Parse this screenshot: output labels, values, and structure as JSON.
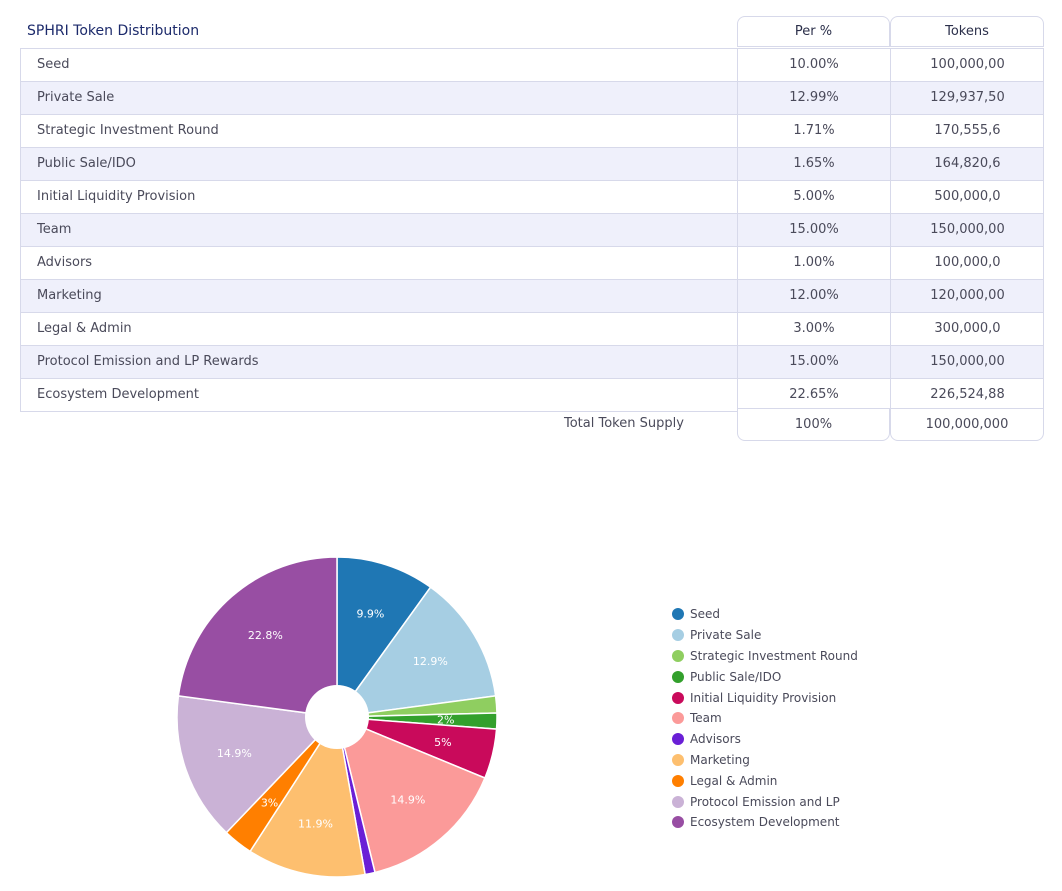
{
  "table": {
    "title": "SPHRI Token Distribution",
    "headers": {
      "per": "Per %",
      "tokens": "Tokens"
    },
    "rows": [
      {
        "name": "Seed",
        "per": "10.00%",
        "tokens": "100,000,00"
      },
      {
        "name": "Private Sale",
        "per": "12.99%",
        "tokens": "129,937,50"
      },
      {
        "name": "Strategic Investment Round",
        "per": "1.71%",
        "tokens": "170,555,6"
      },
      {
        "name": "Public Sale/IDO",
        "per": "1.65%",
        "tokens": "164,820,6"
      },
      {
        "name": "Initial Liquidity Provision",
        "per": "5.00%",
        "tokens": "500,000,0"
      },
      {
        "name": "Team",
        "per": "15.00%",
        "tokens": "150,000,00"
      },
      {
        "name": "Advisors",
        "per": "1.00%",
        "tokens": "100,000,0"
      },
      {
        "name": "Marketing",
        "per": "12.00%",
        "tokens": "120,000,00"
      },
      {
        "name": "Legal & Admin",
        "per": "3.00%",
        "tokens": "300,000,0"
      },
      {
        "name": "Protocol Emission and LP Rewards",
        "per": "15.00%",
        "tokens": "150,000,00"
      },
      {
        "name": "Ecosystem Development",
        "per": "22.65%",
        "tokens": "226,524,88"
      }
    ],
    "total": {
      "label": "Total Token Supply",
      "per": "100%",
      "tokens": "100,000,000"
    }
  },
  "chart_data": {
    "type": "pie",
    "donut": true,
    "legend_position": "right",
    "slices": [
      {
        "label": "Seed",
        "value": 9.9,
        "data_label": "9.9%",
        "color": "#1f77b4"
      },
      {
        "label": "Private Sale",
        "value": 12.9,
        "data_label": "12.9%",
        "color": "#a6cee3"
      },
      {
        "label": "Strategic Investment Round",
        "value": 1.7,
        "data_label": "",
        "color": "#8fce60"
      },
      {
        "label": "Public Sale/IDO",
        "value": 1.6,
        "data_label": "2%",
        "color": "#33a02c"
      },
      {
        "label": "Initial Liquidity Provision",
        "value": 5.0,
        "data_label": "5%",
        "color": "#c90a5b"
      },
      {
        "label": "Team",
        "value": 14.9,
        "data_label": "14.9%",
        "color": "#fb9a99"
      },
      {
        "label": "Advisors",
        "value": 1.0,
        "data_label": "",
        "color": "#6a1fd6"
      },
      {
        "label": "Marketing",
        "value": 11.9,
        "data_label": "11.9%",
        "color": "#fdbf6f"
      },
      {
        "label": "Legal & Admin",
        "value": 3.0,
        "data_label": "3%",
        "color": "#ff7f00"
      },
      {
        "label": "Protocol Emission and LP",
        "value": 14.9,
        "data_label": "14.9%",
        "color": "#cab2d6"
      },
      {
        "label": "Ecosystem Development",
        "value": 22.8,
        "data_label": "22.8%",
        "color": "#984ea3"
      }
    ]
  }
}
